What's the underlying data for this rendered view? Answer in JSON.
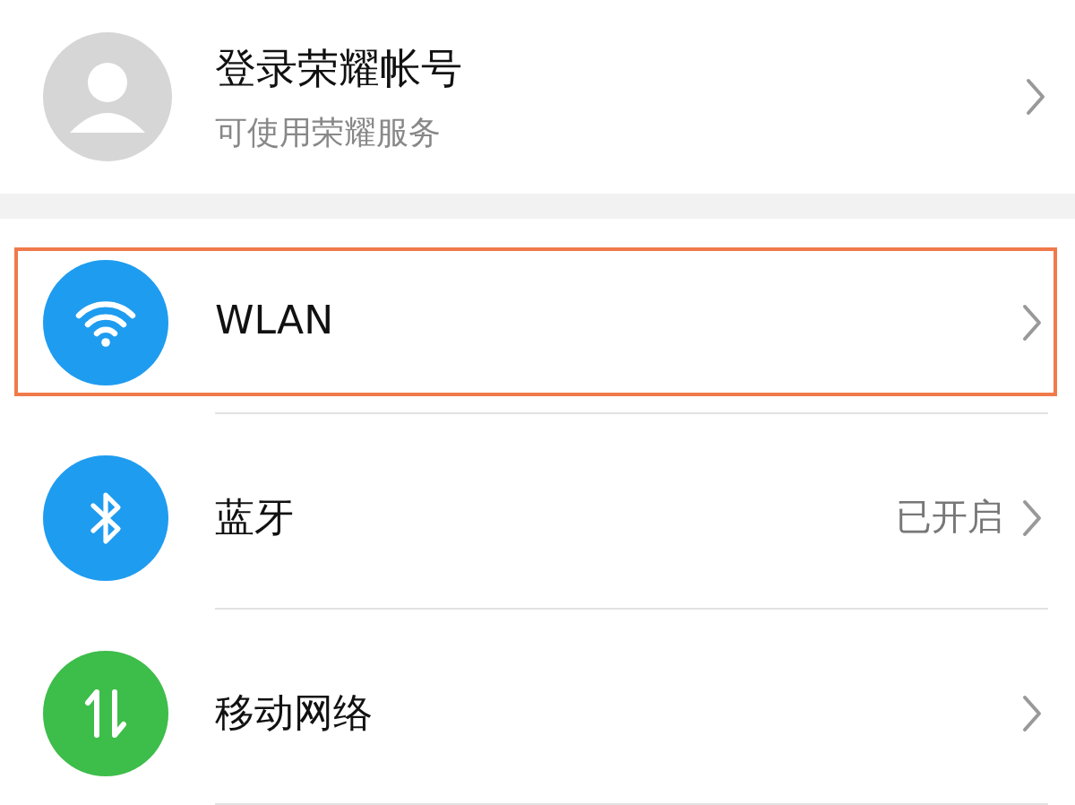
{
  "account": {
    "title": "登录荣耀帐号",
    "subtitle": "可使用荣耀服务"
  },
  "items": [
    {
      "label": "WLAN",
      "kind": "wifi",
      "color": "#1e9cf0",
      "highlighted": true
    },
    {
      "label": "蓝牙",
      "kind": "bluetooth",
      "color": "#1e9cf0",
      "status": "已开启",
      "highlighted": false
    },
    {
      "label": "移动网络",
      "kind": "mobile",
      "color": "#3dbd4a",
      "highlighted": false
    }
  ]
}
